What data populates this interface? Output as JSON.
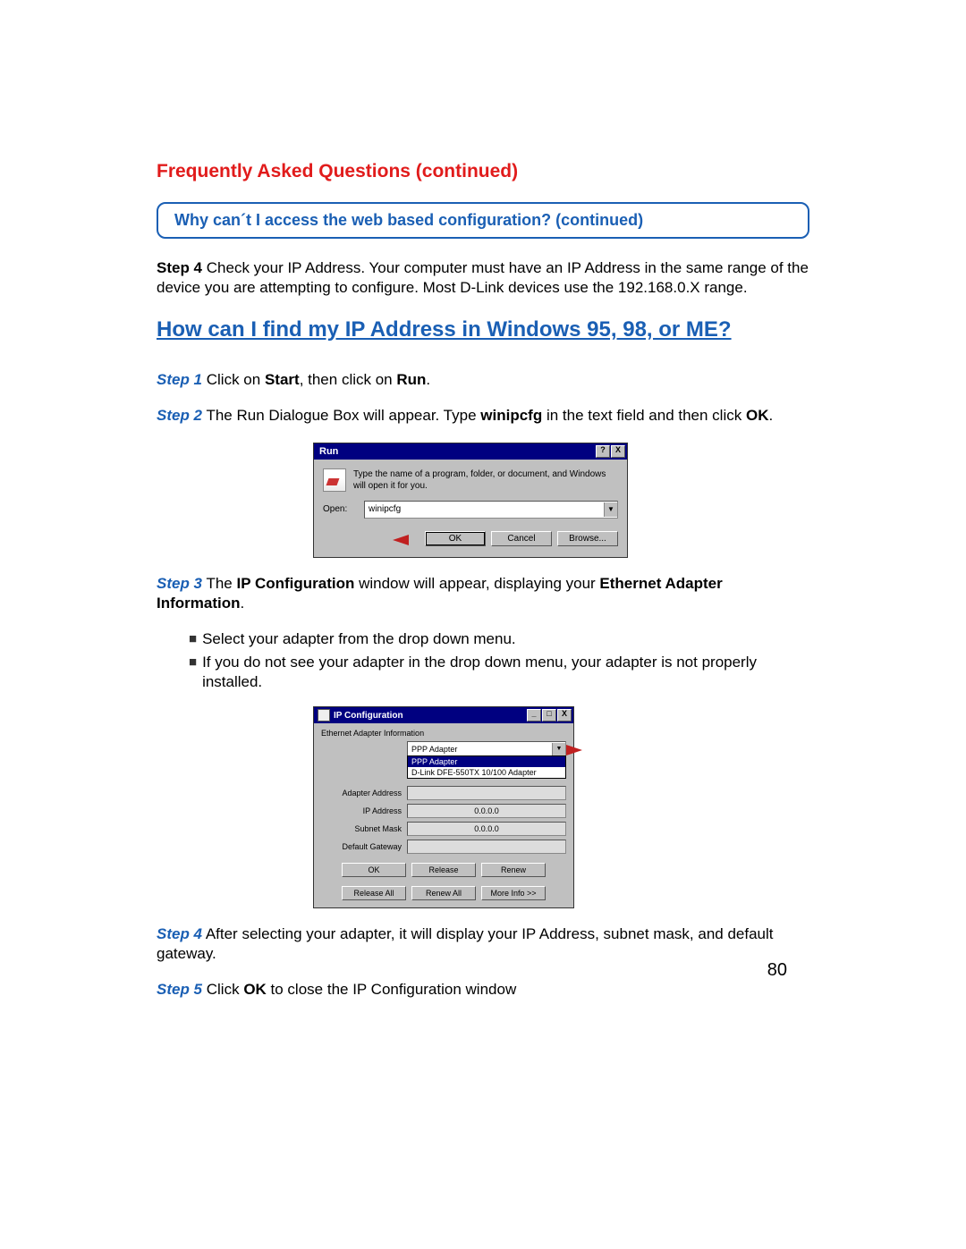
{
  "header": "Frequently Asked Questions (continued)",
  "subsection": "Why can´t I access the web based configuration? (continued)",
  "intro": {
    "step_label": "Step 4",
    "text": " Check your IP Address. Your computer must have an IP Address in the same range of the device you are attempting to configure. Most D-Link devices use the 192.168.0.X range."
  },
  "heading": "How can I find my IP Address in Windows 95, 98, or ME?",
  "step1": {
    "label": "Step 1",
    "pre": " Click on ",
    "b1": "Start",
    "mid": ", then click on ",
    "b2": "Run",
    "end": "."
  },
  "step2": {
    "label": "Step 2",
    "pre": " The Run Dialogue Box will appear. Type ",
    "b1": "winipcfg",
    "mid": " in the text field and then click ",
    "b2": "OK",
    "end": "."
  },
  "run_dialog": {
    "title": "Run",
    "desc": "Type the name of a program, folder, or document, and Windows will open it for you.",
    "open_label": "Open:",
    "value": "winipcfg",
    "buttons": {
      "ok": "OK",
      "cancel": "Cancel",
      "browse": "Browse..."
    }
  },
  "step3": {
    "label": "Step 3",
    "pre": " The ",
    "b1": "IP Configuration",
    "mid": " window will appear, displaying your ",
    "b2": "Ethernet Adapter Information",
    "end": "."
  },
  "bullets": {
    "b1": "Select your adapter from the drop down menu.",
    "b2": "If you do not see your adapter in the drop down menu, your adapter is not properly installed."
  },
  "ipcfg": {
    "title": "IP Configuration",
    "group": "Ethernet Adapter Information",
    "selected": "PPP Adapter",
    "options": {
      "o1": "PPP Adapter",
      "o2": "D-Link DFE-550TX 10/100 Adapter"
    },
    "fields": {
      "adapter_label": "Adapter Address",
      "adapter_val": "",
      "ip_label": "IP Address",
      "ip_val": "0.0.0.0",
      "mask_label": "Subnet Mask",
      "mask_val": "0.0.0.0",
      "gw_label": "Default Gateway",
      "gw_val": ""
    },
    "buttons": {
      "ok": "OK",
      "release": "Release",
      "renew": "Renew",
      "release_all": "Release All",
      "renew_all": "Renew All",
      "more": "More Info >>"
    }
  },
  "step4": {
    "label": "Step 4",
    "text": "  After selecting your adapter, it will display your IP Address, subnet mask, and default gateway."
  },
  "step5": {
    "label": "Step 5",
    "pre": "  Click ",
    "b1": "OK",
    "end": " to close the IP Configuration window"
  },
  "page_number": "80",
  "glyph_question": "?",
  "glyph_close": "X",
  "glyph_min": "_",
  "glyph_max": "□",
  "glyph_drop": "▼"
}
